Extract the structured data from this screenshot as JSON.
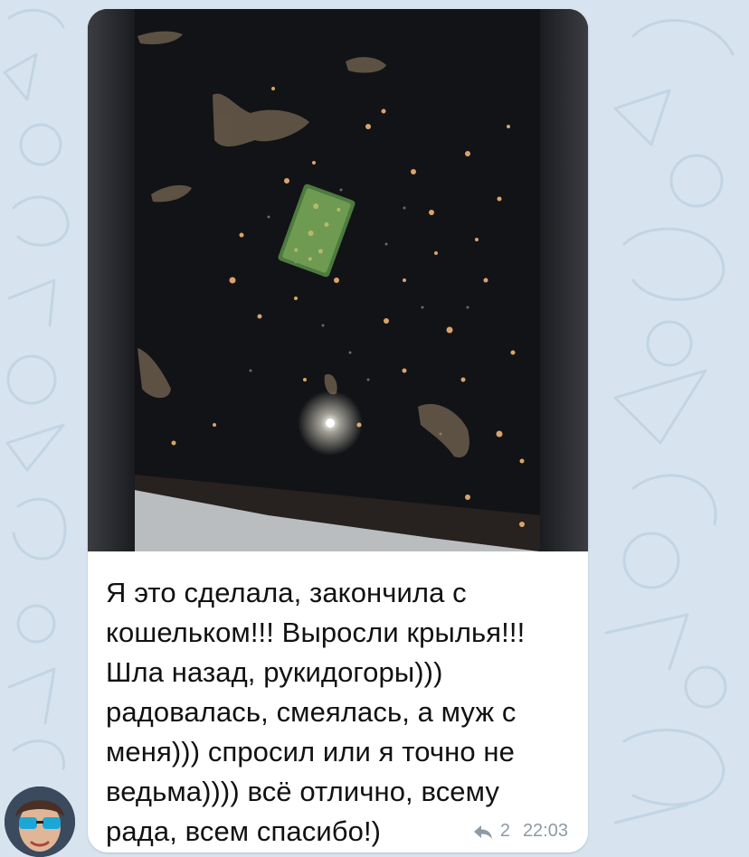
{
  "chat": {
    "wallpaper_color": "#d7e4ef",
    "message": {
      "photo_description_icon": "photo-night-ground-with-green-wallet",
      "text": "Я это сделала, закончила с\nкошельком!!! Выросли крылья!!!\nШла назад, рукидогоры)))\nрадовалась, смеялась, а муж с\nменя))) спросил или я точно не\nведьма)))) всё отлично, всему\nрада, всем спасибо!)",
      "reply_icon": "reply-arrow-icon",
      "reply_count": "2",
      "time": "22:03"
    },
    "sender": {
      "avatar_icon": "avatar-woman-sunglasses"
    }
  }
}
